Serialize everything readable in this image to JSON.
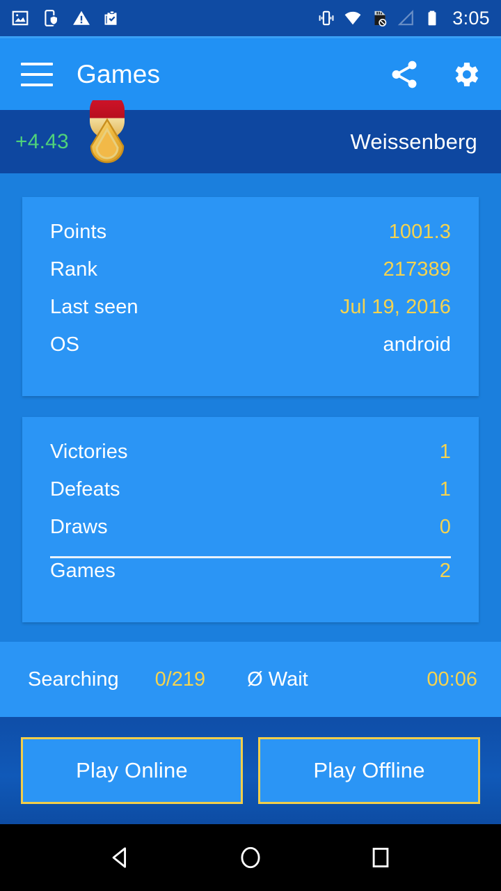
{
  "status_bar": {
    "time": "3:05",
    "left_icons": [
      {
        "name": "image-icon"
      },
      {
        "name": "phone-shield-icon"
      },
      {
        "name": "warning-triangle-icon"
      },
      {
        "name": "clipboard-check-icon"
      }
    ],
    "right_icons": [
      {
        "name": "vibrate-icon"
      },
      {
        "name": "wifi-icon"
      },
      {
        "name": "sd-card-disabled-icon"
      },
      {
        "name": "signal-no-service-icon"
      },
      {
        "name": "battery-icon"
      }
    ]
  },
  "appbar": {
    "title": "Games",
    "menu_icon": "hamburger-menu-icon",
    "share_icon": "share-icon",
    "settings_icon": "gear-icon"
  },
  "player_header": {
    "delta": "+4.43",
    "badge_icon": "rank-medal-icon",
    "name": "Weissenberg"
  },
  "stats_card": {
    "rows": [
      {
        "label": "Points",
        "value": "1001.3",
        "style": "accent"
      },
      {
        "label": "Rank",
        "value": "217389",
        "style": "accent"
      },
      {
        "label": "Last seen",
        "value": "Jul 19, 2016",
        "style": "accent"
      },
      {
        "label": "OS",
        "value": "android",
        "style": "plain"
      }
    ]
  },
  "record_card": {
    "rows": [
      {
        "label": "Victories",
        "value": "1"
      },
      {
        "label": "Defeats",
        "value": "1"
      },
      {
        "label": "Draws",
        "value": "0"
      }
    ],
    "total": {
      "label": "Games",
      "value": "2"
    }
  },
  "search_strip": {
    "status_label": "Searching",
    "status_value": "0/219",
    "wait_label": "Ø Wait",
    "wait_value": "00:06"
  },
  "actions": {
    "play_online": "Play Online",
    "play_offline": "Play Offline"
  },
  "navbar": {
    "back": "back-button",
    "home": "home-button",
    "recents": "recents-button"
  },
  "colors": {
    "accent_yellow": "#f4d350",
    "positive_green": "#4fd27a",
    "card_blue": "#2b95f5",
    "page_blue": "#1b7fdd",
    "appbar_blue": "#2191f4",
    "header_blue": "#0e47a0",
    "button_border": "#f2ce4a"
  }
}
